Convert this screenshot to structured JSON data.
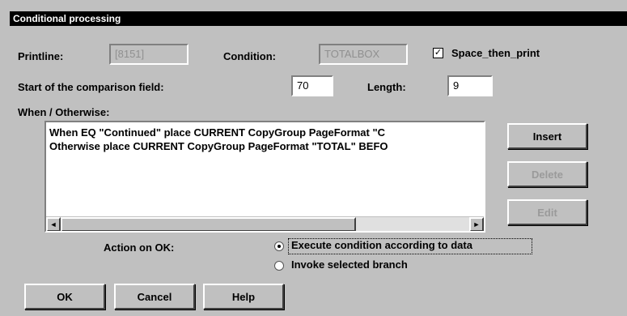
{
  "window": {
    "title": "Conditional processing"
  },
  "printline": {
    "label": "Printline:",
    "value": "[8151]"
  },
  "condition": {
    "label": "Condition:",
    "value": "TOTALBOX"
  },
  "space_then_print": {
    "label": "Space_then_print",
    "checked": true,
    "mark": "✓"
  },
  "start_field": {
    "label": "Start of the comparison field:",
    "value": "70"
  },
  "length": {
    "label": "Length:",
    "value": "9"
  },
  "when_otherwise": {
    "label": "When / Otherwise:",
    "lines": [
      "When EQ \"Continued\" place CURRENT CopyGroup PageFormat \"C",
      "Otherwise place CURRENT CopyGroup PageFormat \"TOTAL\" BEFO"
    ]
  },
  "side_buttons": {
    "insert": "Insert",
    "delete": "Delete",
    "edit": "Edit"
  },
  "scroll": {
    "left_arrow": "◄",
    "right_arrow": "►"
  },
  "action": {
    "label": "Action on OK:",
    "options": [
      "Execute condition according to data",
      "Invoke selected branch"
    ],
    "selected": "Execute condition according to data"
  },
  "bottom_buttons": {
    "ok": "OK",
    "cancel": "Cancel",
    "help": "Help"
  }
}
